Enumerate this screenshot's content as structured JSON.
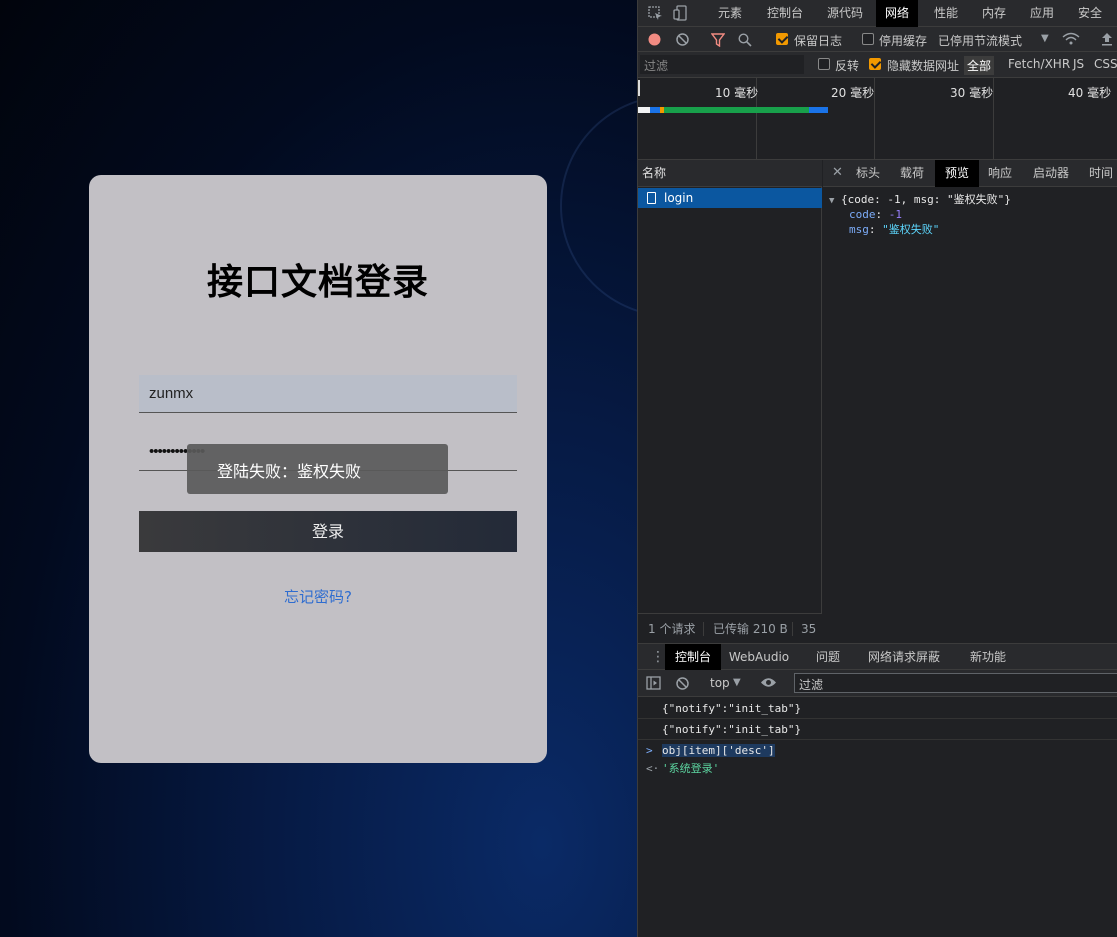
{
  "login": {
    "title": "接口文档登录",
    "username_value": "zunmx",
    "password_mask": "•••••••••••••",
    "toast": "登陆失败：鉴权失败",
    "login_label": "登录",
    "forgot_label": "忘记密码?"
  },
  "devtools": {
    "main_tabs": [
      "元素",
      "控制台",
      "源代码",
      "网络",
      "性能",
      "内存",
      "应用",
      "安全"
    ],
    "active_tab": "网络",
    "toolbar": {
      "preserve_log": "保留日志",
      "disable_cache": "停用缓存",
      "throttle": "已停用节流模式"
    },
    "filter": {
      "placeholder": "过滤",
      "invert": "反转",
      "hide_data_urls": "隐藏数据网址",
      "types": [
        "全部",
        "Fetch/XHR",
        "JS",
        "CSS"
      ]
    },
    "timeline": {
      "labels": [
        "10 毫秒",
        "20 毫秒",
        "30 毫秒",
        "40 毫秒"
      ]
    },
    "requests": {
      "header": "名称",
      "items": [
        "login"
      ]
    },
    "status": {
      "count": "1 个请求",
      "transferred": "已传输 210 B",
      "extra": "35"
    },
    "detail_tabs": [
      "标头",
      "载荷",
      "预览",
      "响应",
      "启动器",
      "时间"
    ],
    "active_detail_tab": "预览",
    "preview": {
      "summary": "{code: -1, msg: \"鉴权失败\"}",
      "code_key": "code",
      "code_value": "-1",
      "msg_key": "msg",
      "msg_value": "\"鉴权失败\""
    },
    "drawer_tabs": [
      "控制台",
      "WebAudio",
      "问题",
      "网络请求屏蔽",
      "新功能"
    ],
    "active_drawer_tab": "控制台",
    "console": {
      "context": "top",
      "filter_placeholder": "过滤",
      "logs": [
        "{\"notify\":\"init_tab\"}",
        "{\"notify\":\"init_tab\"}"
      ],
      "input": "obj[item]['desc']",
      "result": "'系统登录'"
    }
  }
}
